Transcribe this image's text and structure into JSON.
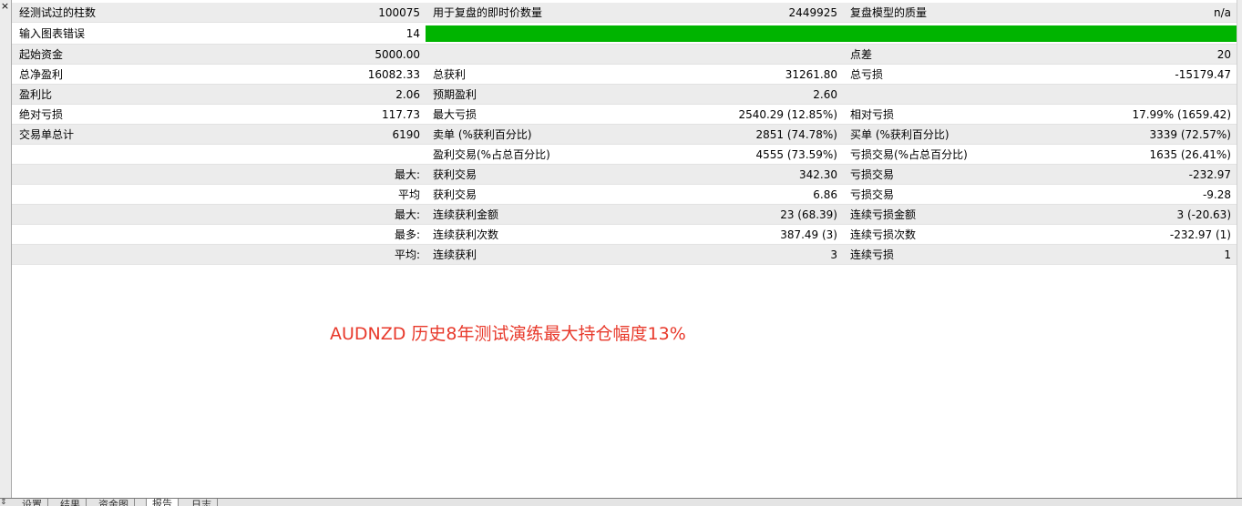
{
  "window": {
    "close_glyph": "×"
  },
  "report": {
    "rows": [
      {
        "c1": "经测试过的柱数",
        "c2": "100075",
        "c3": "用于复盘的即时价数量",
        "c4": "2449925",
        "c5": "复盘模型的质量",
        "c6": "n/a"
      },
      {
        "c1": "输入图表错误",
        "c2": "14",
        "bar": "green"
      },
      {
        "c1": "起始资金",
        "c2": "5000.00",
        "c3": "",
        "c4": "",
        "c5": "点差",
        "c6": "20"
      },
      {
        "c1": "总净盈利",
        "c2": "16082.33",
        "c3": "总获利",
        "c4": "31261.80",
        "c5": "总亏损",
        "c6": "-15179.47"
      },
      {
        "c1": "盈利比",
        "c2": "2.06",
        "c3": "预期盈利",
        "c4": "2.60",
        "c5": "",
        "c6": ""
      },
      {
        "c1": "绝对亏损",
        "c2": "117.73",
        "c3": "最大亏损",
        "c4": "2540.29 (12.85%)",
        "c5": "相对亏损",
        "c6": "17.99% (1659.42)"
      },
      {
        "c1": "交易单总计",
        "c2": "6190",
        "c3": "卖单 (%获利百分比)",
        "c4": "2851 (74.78%)",
        "c5": "买单 (%获利百分比)",
        "c6": "3339 (72.57%)"
      },
      {
        "c1": "",
        "c2": "",
        "c3": "盈利交易(%占总百分比)",
        "c4": "4555 (73.59%)",
        "c5": "亏损交易(%占总百分比)",
        "c6": "1635 (26.41%)"
      },
      {
        "c1": "",
        "c2": "最大:",
        "c3": "获利交易",
        "c4": "342.30",
        "c5": "亏损交易",
        "c6": "-232.97"
      },
      {
        "c1": "",
        "c2": "平均",
        "c3": "获利交易",
        "c4": "6.86",
        "c5": "亏损交易",
        "c6": "-9.28"
      },
      {
        "c1": "",
        "c2": "最大:",
        "c3": "连续获利金额",
        "c4": "23 (68.39)",
        "c5": "连续亏损金额",
        "c6": "3 (-20.63)"
      },
      {
        "c1": "",
        "c2": "最多:",
        "c3": "连续获利次数",
        "c4": "387.49 (3)",
        "c5": "连续亏损次数",
        "c6": "-232.97 (1)"
      },
      {
        "c1": "",
        "c2": "平均:",
        "c3": "连续获利",
        "c4": "3",
        "c5": "连续亏损",
        "c6": "1"
      }
    ]
  },
  "annotation": "AUDNZD 历史8年测试演练最大持仓幅度13%",
  "tabs": [
    {
      "label": "设置",
      "active": false
    },
    {
      "label": "结果",
      "active": false
    },
    {
      "label": "资金图",
      "active": false
    },
    {
      "label": "报告",
      "active": true
    },
    {
      "label": "日志",
      "active": false
    }
  ],
  "colors": {
    "progress_green": "#00b400",
    "annotation_red": "#e8392b"
  }
}
